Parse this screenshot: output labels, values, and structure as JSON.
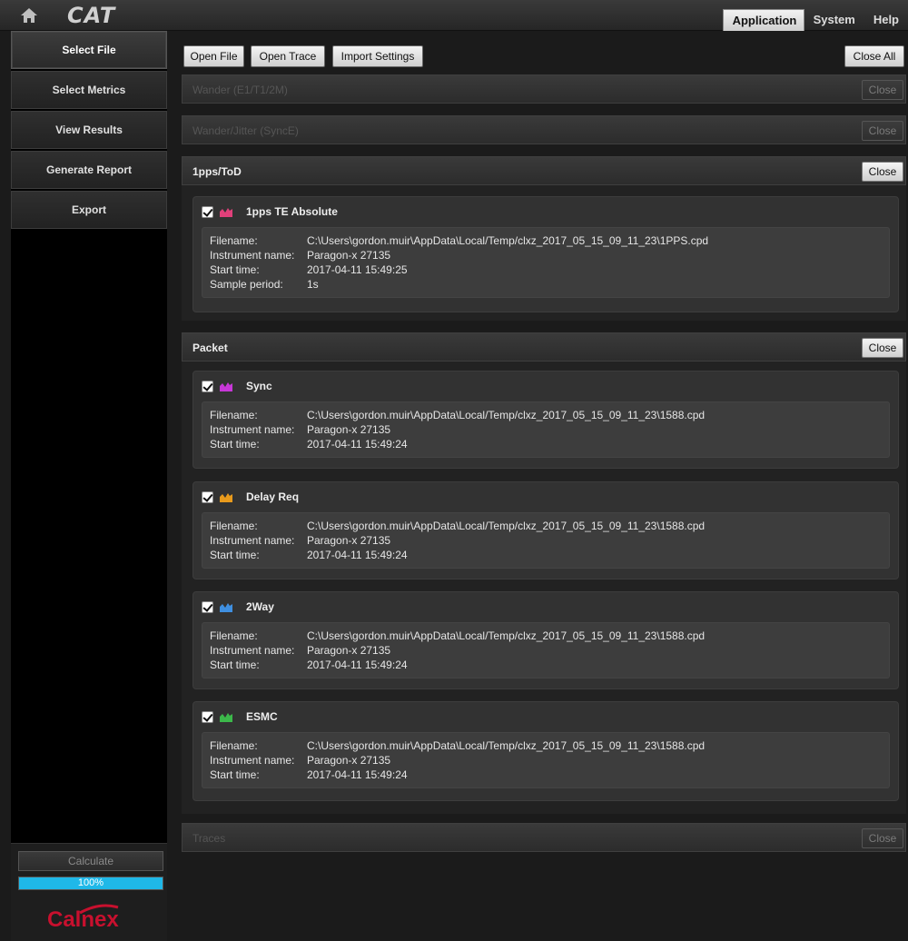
{
  "app": {
    "logo_text": "CAT",
    "nav": [
      {
        "label": "Application"
      },
      {
        "label": "System"
      },
      {
        "label": "Help"
      }
    ]
  },
  "sidebar": {
    "items": [
      {
        "label": "Select File"
      },
      {
        "label": "Select Metrics"
      },
      {
        "label": "View Results"
      },
      {
        "label": "Generate Report"
      },
      {
        "label": "Export"
      }
    ],
    "calculate_label": "Calculate",
    "progress_value": 1.0,
    "progress_text": "100%",
    "brand": "Calnex"
  },
  "toolbar": {
    "open_file": "Open File",
    "open_trace": "Open Trace",
    "import_settings": "Import Settings",
    "close_all": "Close All"
  },
  "labels": {
    "close": "Close",
    "filename": "Filename:",
    "instrument": "Instrument name:",
    "start": "Start time:",
    "sample": "Sample period:"
  },
  "sections": [
    {
      "title": "Wander (E1/T1/2M)",
      "enabled": false
    },
    {
      "title": "Wander/Jitter (SyncE)",
      "enabled": false
    },
    {
      "title": "1pps/ToD",
      "enabled": true
    },
    {
      "title": "Packet",
      "enabled": true
    },
    {
      "title": "Traces",
      "enabled": false
    }
  ],
  "cards": [
    {
      "name": "1pps TE Absolute",
      "icon_color": "#e0407a",
      "filename": "C:\\Users\\gordon.muir\\AppData\\Local/Temp/clxz_2017_05_15_09_11_23\\1PPS.cpd",
      "instrument": "Paragon-x 27135",
      "start": "2017-04-11 15:49:25",
      "sample": "1s"
    },
    {
      "name": "Sync",
      "icon_color": "#c838d8",
      "filename": "C:\\Users\\gordon.muir\\AppData\\Local/Temp/clxz_2017_05_15_09_11_23\\1588.cpd",
      "instrument": "Paragon-x 27135",
      "start": "2017-04-11 15:49:24"
    },
    {
      "name": "Delay Req",
      "icon_color": "#e89a1c",
      "filename": "C:\\Users\\gordon.muir\\AppData\\Local/Temp/clxz_2017_05_15_09_11_23\\1588.cpd",
      "instrument": "Paragon-x 27135",
      "start": "2017-04-11 15:49:24"
    },
    {
      "name": "2Way",
      "icon_color": "#3f8fe0",
      "filename": "C:\\Users\\gordon.muir\\AppData\\Local/Temp/clxz_2017_05_15_09_11_23\\1588.cpd",
      "instrument": "Paragon-x 27135",
      "start": "2017-04-11 15:49:24"
    },
    {
      "name": "ESMC",
      "icon_color": "#3cb84a",
      "filename": "C:\\Users\\gordon.muir\\AppData\\Local/Temp/clxz_2017_05_15_09_11_23\\1588.cpd",
      "instrument": "Paragon-x 27135",
      "start": "2017-04-11 15:49:24"
    }
  ]
}
